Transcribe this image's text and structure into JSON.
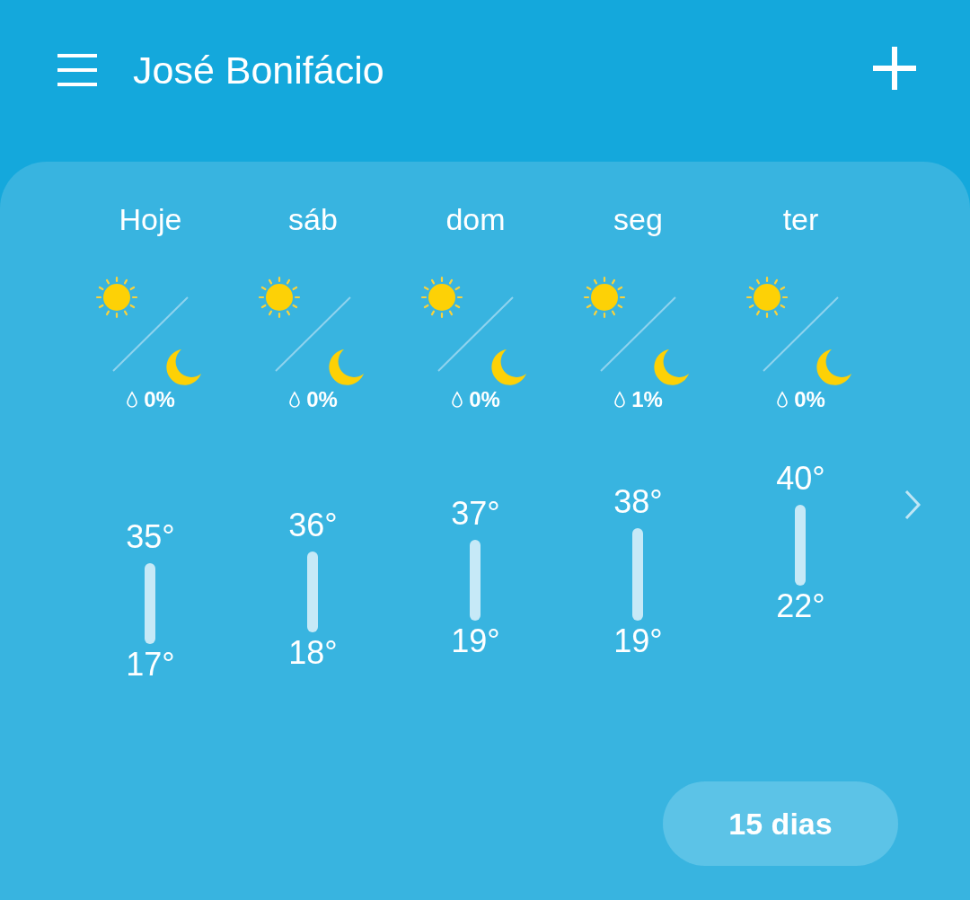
{
  "header": {
    "title": "José Bonifácio"
  },
  "days": [
    {
      "label": "Hoje",
      "precipitation": "0%",
      "high": "35°",
      "low": "17°"
    },
    {
      "label": "sáb",
      "precipitation": "0%",
      "high": "36°",
      "low": "18°"
    },
    {
      "label": "dom",
      "precipitation": "0%",
      "high": "37°",
      "low": "19°"
    },
    {
      "label": "seg",
      "precipitation": "1%",
      "high": "38°",
      "low": "19°"
    },
    {
      "label": "ter",
      "precipitation": "0%",
      "high": "40°",
      "low": "22°"
    }
  ],
  "more_button": "15 dias"
}
